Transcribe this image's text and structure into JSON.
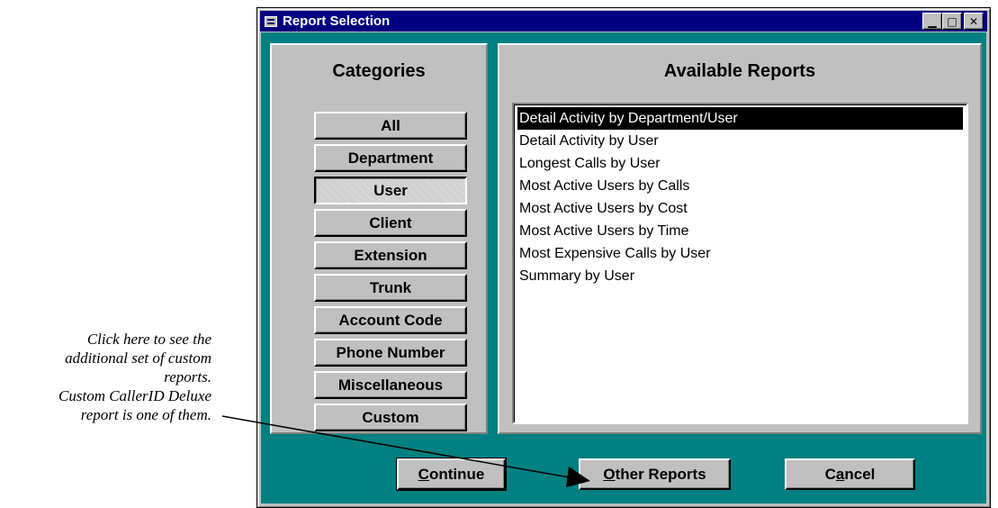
{
  "window": {
    "title": "Report Selection",
    "controls": [
      "minimize",
      "maximize",
      "close"
    ]
  },
  "categories": {
    "heading": "Categories",
    "items": [
      {
        "label": "All",
        "pressed": false
      },
      {
        "label": "Department",
        "pressed": false
      },
      {
        "label": "User",
        "pressed": true
      },
      {
        "label": "Client",
        "pressed": false
      },
      {
        "label": "Extension",
        "pressed": false
      },
      {
        "label": "Trunk",
        "pressed": false
      },
      {
        "label": "Account Code",
        "pressed": false
      },
      {
        "label": "Phone Number",
        "pressed": false
      },
      {
        "label": "Miscellaneous",
        "pressed": false
      },
      {
        "label": "Custom",
        "pressed": false
      }
    ]
  },
  "reports": {
    "heading": "Available Reports",
    "selected_index": 0,
    "items": [
      "Detail Activity by Department/User",
      "Detail Activity by User",
      "Longest Calls by User",
      "Most Active Users by Calls",
      "Most Active Users by Cost",
      "Most Active Users by Time",
      "Most Expensive Calls by User",
      "Summary by User"
    ]
  },
  "buttons": {
    "continue": {
      "label": "Continue",
      "mnemonic": "C"
    },
    "other_reports": {
      "label": "Other Reports",
      "mnemonic": "O"
    },
    "cancel": {
      "label": "Cancel",
      "mnemonic": "a"
    }
  },
  "annotation": {
    "lines": [
      "Click here to see the",
      "additional set of custom",
      "reports.",
      "Custom CallerID Deluxe",
      "report is one of them."
    ]
  },
  "colors": {
    "client_background": "#008080",
    "title_bar": "#000080",
    "face": "#c0c0c0",
    "selection": "#000000"
  }
}
